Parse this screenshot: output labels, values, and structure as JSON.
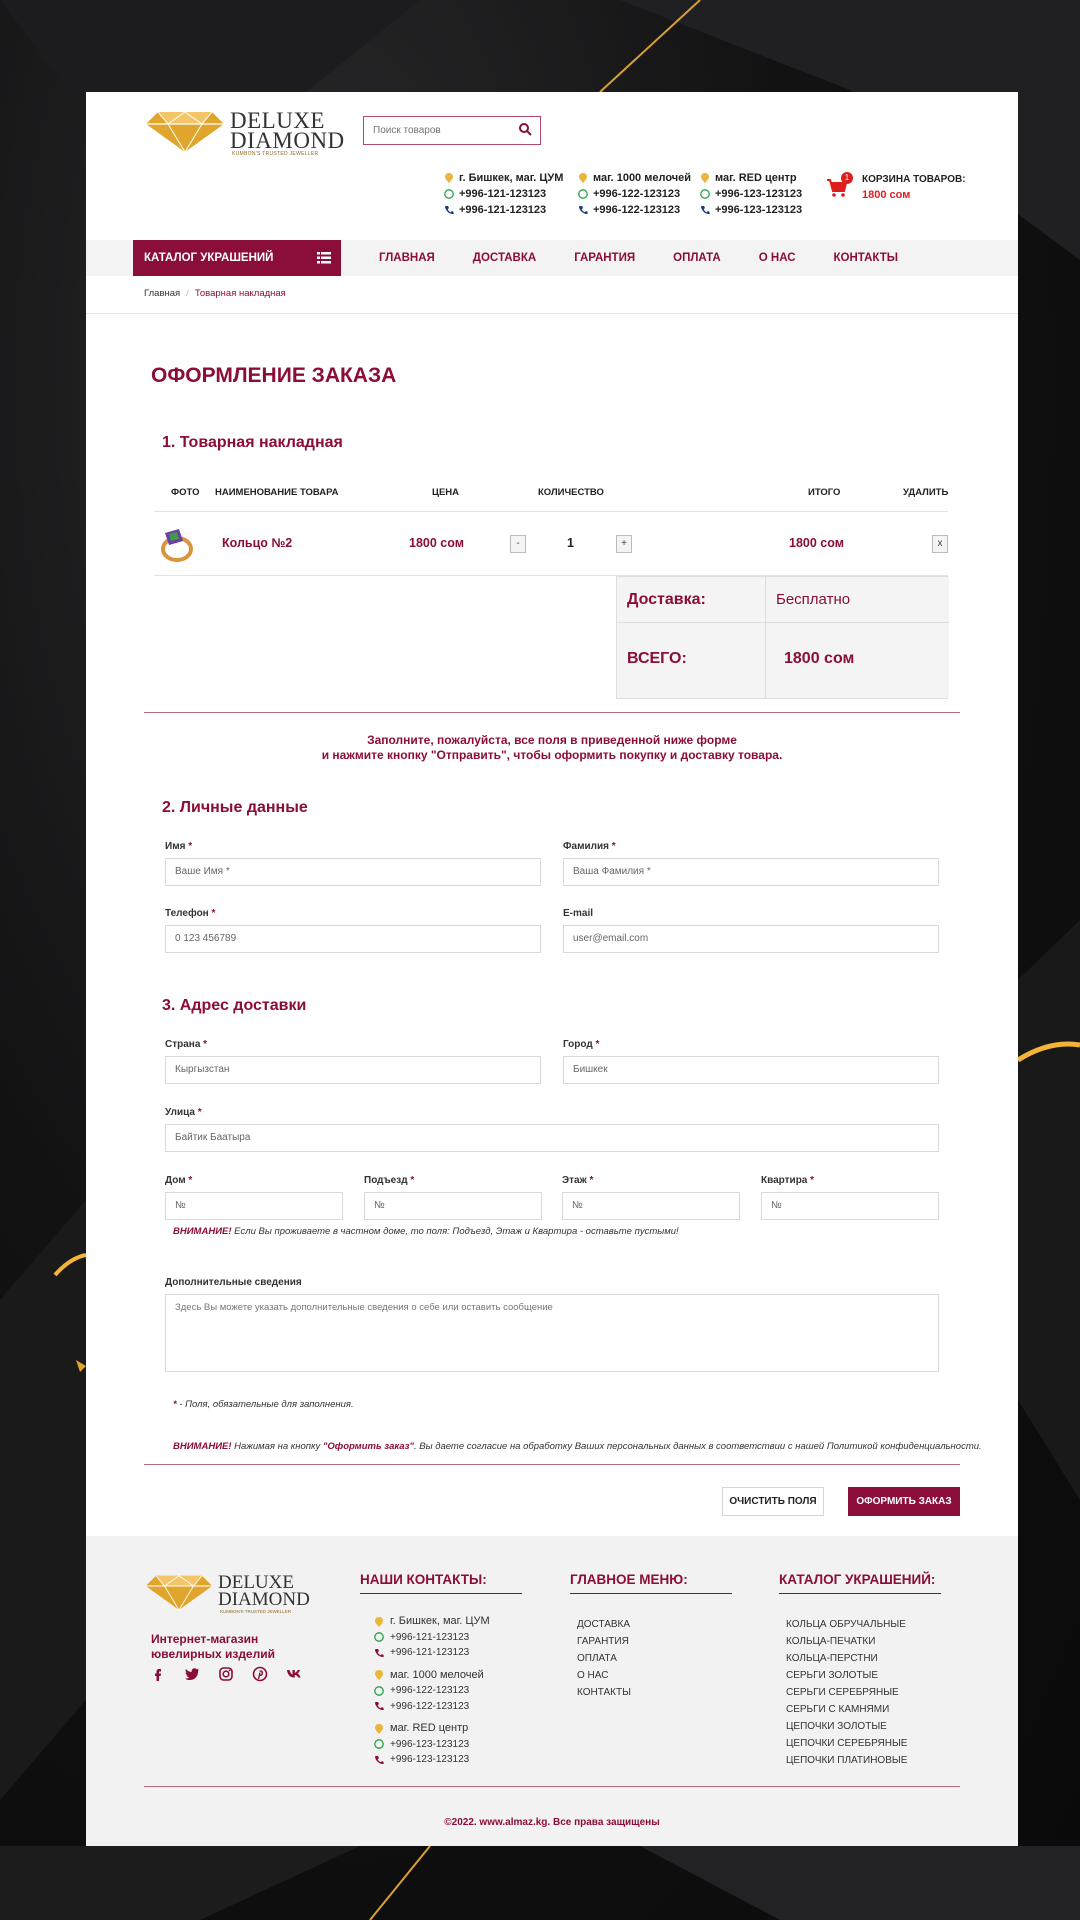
{
  "brand": {
    "line1": "DELUXE",
    "line2": "DIAMOND",
    "tagline": "KUMBON'S TRUSTED JEWELLER"
  },
  "search": {
    "placeholder": "Поиск товаров"
  },
  "stores": [
    {
      "name": "г. Бишкек, маг. ЦУМ",
      "whatsapp": "+996-121-123123",
      "phone": "+996-121-123123"
    },
    {
      "name": "маг. 1000 мелочей",
      "whatsapp": "+996-122-123123",
      "phone": "+996-122-123123"
    },
    {
      "name": "маг. RED центр",
      "whatsapp": "+996-123-123123",
      "phone": "+996-123-123123"
    }
  ],
  "cart": {
    "badge": "1",
    "label": "КОРЗИНА ТОВАРОВ:",
    "total": "1800 сом"
  },
  "nav": {
    "catalog": "КАТАЛОГ УКРАШЕНИЙ",
    "links": [
      "ГЛАВНАЯ",
      "ДОСТАВКА",
      "ГАРАНТИЯ",
      "ОПЛАТА",
      "О НАС",
      "КОНТАКТЫ"
    ]
  },
  "breadcrumb": {
    "home": "Главная",
    "separator": "/",
    "current": "Товарная накладная"
  },
  "page_title": "ОФОРМЛЕНИЕ ЗАКАЗА",
  "section1": {
    "title": "1. Товарная накладная",
    "headers": {
      "photo": "ФОТО",
      "name": "НАИМЕНОВАНИЕ ТОВАРА",
      "price": "ЦЕНА",
      "qty": "КОЛИЧЕСТВО",
      "total": "ИТОГО",
      "delete": "УДАЛИТЬ"
    },
    "item": {
      "name": "Кольцо №2",
      "price": "1800 сом",
      "qty": "1",
      "total": "1800 сом",
      "minus": "-",
      "plus": "+",
      "remove": "x"
    },
    "delivery_label": "Доставка:",
    "delivery_value": "Бесплатно",
    "sum_label": "ВСЕГО:",
    "sum_value": "1800 сом"
  },
  "notice": {
    "line1": "Заполните, пожалуйста, все поля в приведенной ниже форме",
    "line2": "и нажмите кнопку \"Отправить\", чтобы оформить покупку и доставку товара."
  },
  "section2": {
    "title": "2. Личные данные",
    "name": {
      "label": "Имя",
      "placeholder": "Ваше Имя *"
    },
    "surname": {
      "label": "Фамилия",
      "placeholder": "Ваша Фамилия *"
    },
    "phone": {
      "label": "Телефон",
      "placeholder": "0 123 456789"
    },
    "email": {
      "label": "E-mail",
      "placeholder": "user@email.com"
    }
  },
  "section3": {
    "title": "3. Адрес доставки",
    "country": {
      "label": "Страна",
      "placeholder": "Кыргызстан"
    },
    "city": {
      "label": "Город",
      "placeholder": "Бишкек"
    },
    "street": {
      "label": "Улица",
      "placeholder": "Байтик Баатыра"
    },
    "house": {
      "label": "Дом",
      "placeholder": "№"
    },
    "entrance": {
      "label": "Подъезд",
      "placeholder": "№"
    },
    "floor": {
      "label": "Этаж",
      "placeholder": "№"
    },
    "flat": {
      "label": "Квартира",
      "placeholder": "№"
    },
    "private_warn_bold": "ВНИМАНИЕ!",
    "private_warn_text": " Если Вы проживаете в частном доме, то поля: Подъезд, Этаж и Квартира - оставьте пустыми!",
    "extra": {
      "label": "Дополнительные сведения",
      "placeholder": "Здесь Вы можете указать дополнительные сведения о себе или оставить сообщение"
    },
    "required_star": "*",
    "required_note": " - Поля, обязательные для заполнения.",
    "consent_bold": "ВНИМАНИЕ!",
    "consent_pre": " Нажимая на кнопку ",
    "consent_button": "\"Оформить заказ\"",
    "consent_post": ". Вы даете согласие на обработку Ваших персональных данных в соответствии с нашей Политикой конфиденциальности."
  },
  "required_mark": "*",
  "buttons": {
    "clear": "ОЧИСТИТЬ ПОЛЯ",
    "order": "ОФОРМИТЬ ЗАКАЗ"
  },
  "footer": {
    "shop_text": "Интернет-магазин ювелирных изделий",
    "contacts_title": "НАШИ КОНТАКТЫ:",
    "menu_title": "ГЛАВНОЕ МЕНЮ:",
    "menu": [
      "ДОСТАВКА",
      "ГАРАНТИЯ",
      "ОПЛАТА",
      "О НАС",
      "КОНТАКТЫ"
    ],
    "catalog_title": "КАТАЛОГ УКРАШЕНИЙ:",
    "catalog": [
      "КОЛЬЦА ОБРУЧАЛЬНЫЕ",
      "КОЛЬЦА-ПЕЧАТКИ",
      "КОЛЬЦА-ПЕРСТНИ",
      "СЕРЬГИ ЗОЛОТЫЕ",
      "СЕРЬГИ СЕРЕБРЯНЫЕ",
      "СЕРЬГИ С КАМНЯМИ",
      "ЦЕПОЧКИ ЗОЛОТЫЕ",
      "ЦЕПОЧКИ СЕРЕБРЯНЫЕ",
      "ЦЕПОЧКИ ПЛАТИНОВЫЕ"
    ],
    "social": [
      "facebook-icon",
      "twitter-icon",
      "instagram-icon",
      "pinterest-icon",
      "vk-icon"
    ],
    "copyright": "©2022. www.almaz.kg. Все права защищены"
  },
  "colors": {
    "accent": "#8b0d3a",
    "gold": "#e0a52c",
    "cart_red": "#e01d1d",
    "whatsapp": "#25a244",
    "phone": "#1b3a8c"
  }
}
